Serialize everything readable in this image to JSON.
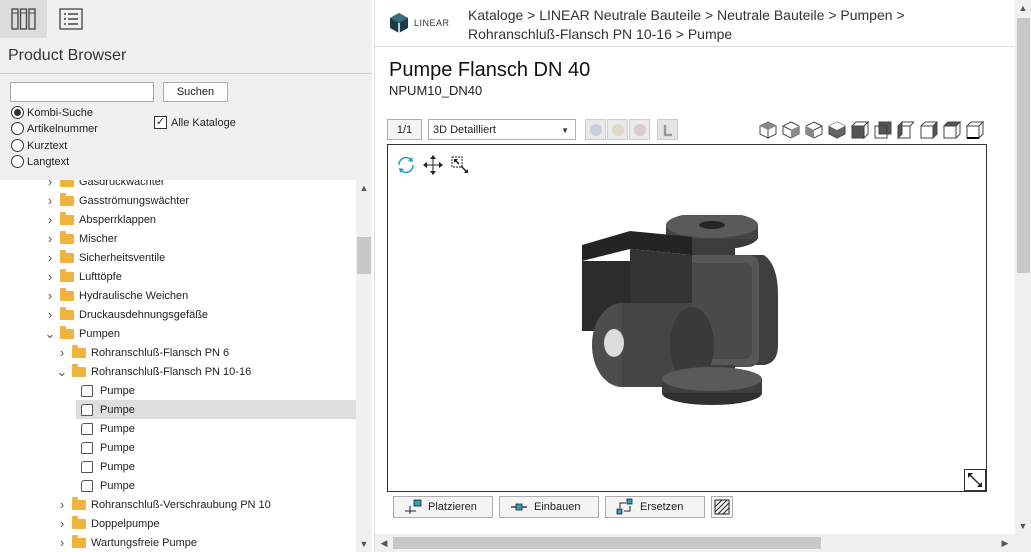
{
  "sidebar": {
    "title": "Product Browser",
    "search": {
      "value": "",
      "button": "Suchen"
    },
    "radios": [
      {
        "label": "Kombi-Suche",
        "checked": true
      },
      {
        "label": "Artikelnummer",
        "checked": false
      },
      {
        "label": "Kurztext",
        "checked": false
      },
      {
        "label": "Langtext",
        "checked": false
      }
    ],
    "all_catalogs": {
      "label": "Alle Kataloge",
      "checked": true,
      "mark": "✓"
    },
    "tree": [
      {
        "level": 0,
        "type": "folder",
        "expanded": false,
        "label": "Gasdruckwächter"
      },
      {
        "level": 0,
        "type": "folder",
        "expanded": false,
        "label": "Gasströmungswächter"
      },
      {
        "level": 0,
        "type": "folder",
        "expanded": false,
        "label": "Absperrklappen"
      },
      {
        "level": 0,
        "type": "folder",
        "expanded": false,
        "label": "Mischer"
      },
      {
        "level": 0,
        "type": "folder",
        "expanded": false,
        "label": "Sicherheitsventile"
      },
      {
        "level": 0,
        "type": "folder",
        "expanded": false,
        "label": "Lufttöpfe"
      },
      {
        "level": 0,
        "type": "folder",
        "expanded": false,
        "label": "Hydraulische Weichen"
      },
      {
        "level": 0,
        "type": "folder",
        "expanded": false,
        "label": "Druckausdehnungsgefäße"
      },
      {
        "level": 0,
        "type": "folder",
        "expanded": true,
        "label": "Pumpen"
      },
      {
        "level": 1,
        "type": "folder",
        "expanded": false,
        "label": "Rohranschluß-Flansch PN 6"
      },
      {
        "level": 1,
        "type": "folder",
        "expanded": true,
        "label": "Rohranschluß-Flansch PN 10-16"
      },
      {
        "level": 2,
        "type": "item",
        "label": "Pumpe"
      },
      {
        "level": 2,
        "type": "item",
        "label": "Pumpe",
        "selected": true
      },
      {
        "level": 2,
        "type": "item",
        "label": "Pumpe"
      },
      {
        "level": 2,
        "type": "item",
        "label": "Pumpe"
      },
      {
        "level": 2,
        "type": "item",
        "label": "Pumpe"
      },
      {
        "level": 2,
        "type": "item",
        "label": "Pumpe"
      },
      {
        "level": 1,
        "type": "folder",
        "expanded": false,
        "label": "Rohranschluß-Verschraubung PN 10"
      },
      {
        "level": 1,
        "type": "folder",
        "expanded": false,
        "label": "Doppelpumpe"
      },
      {
        "level": 1,
        "type": "folder",
        "expanded": false,
        "label": "Wartungsfreie Pumpe"
      }
    ]
  },
  "header": {
    "logo_text": "LINEAR",
    "breadcrumb": "Kataloge > LINEAR Neutrale Bauteile > Neutrale Bauteile > Pumpen  > Rohranschluß-Flansch PN 10-16 > Pumpe"
  },
  "product": {
    "title": "Pumpe Flansch DN  40",
    "code": "NPUM10_DN40"
  },
  "toolbar": {
    "page": "1/1",
    "view_mode": "3D Detailliert"
  },
  "actions": {
    "place": "Platzieren",
    "install": "Einbauen",
    "replace": "Ersetzen"
  },
  "colors": {
    "folder": "#f0b43c",
    "accent": "#2aa0b8"
  }
}
